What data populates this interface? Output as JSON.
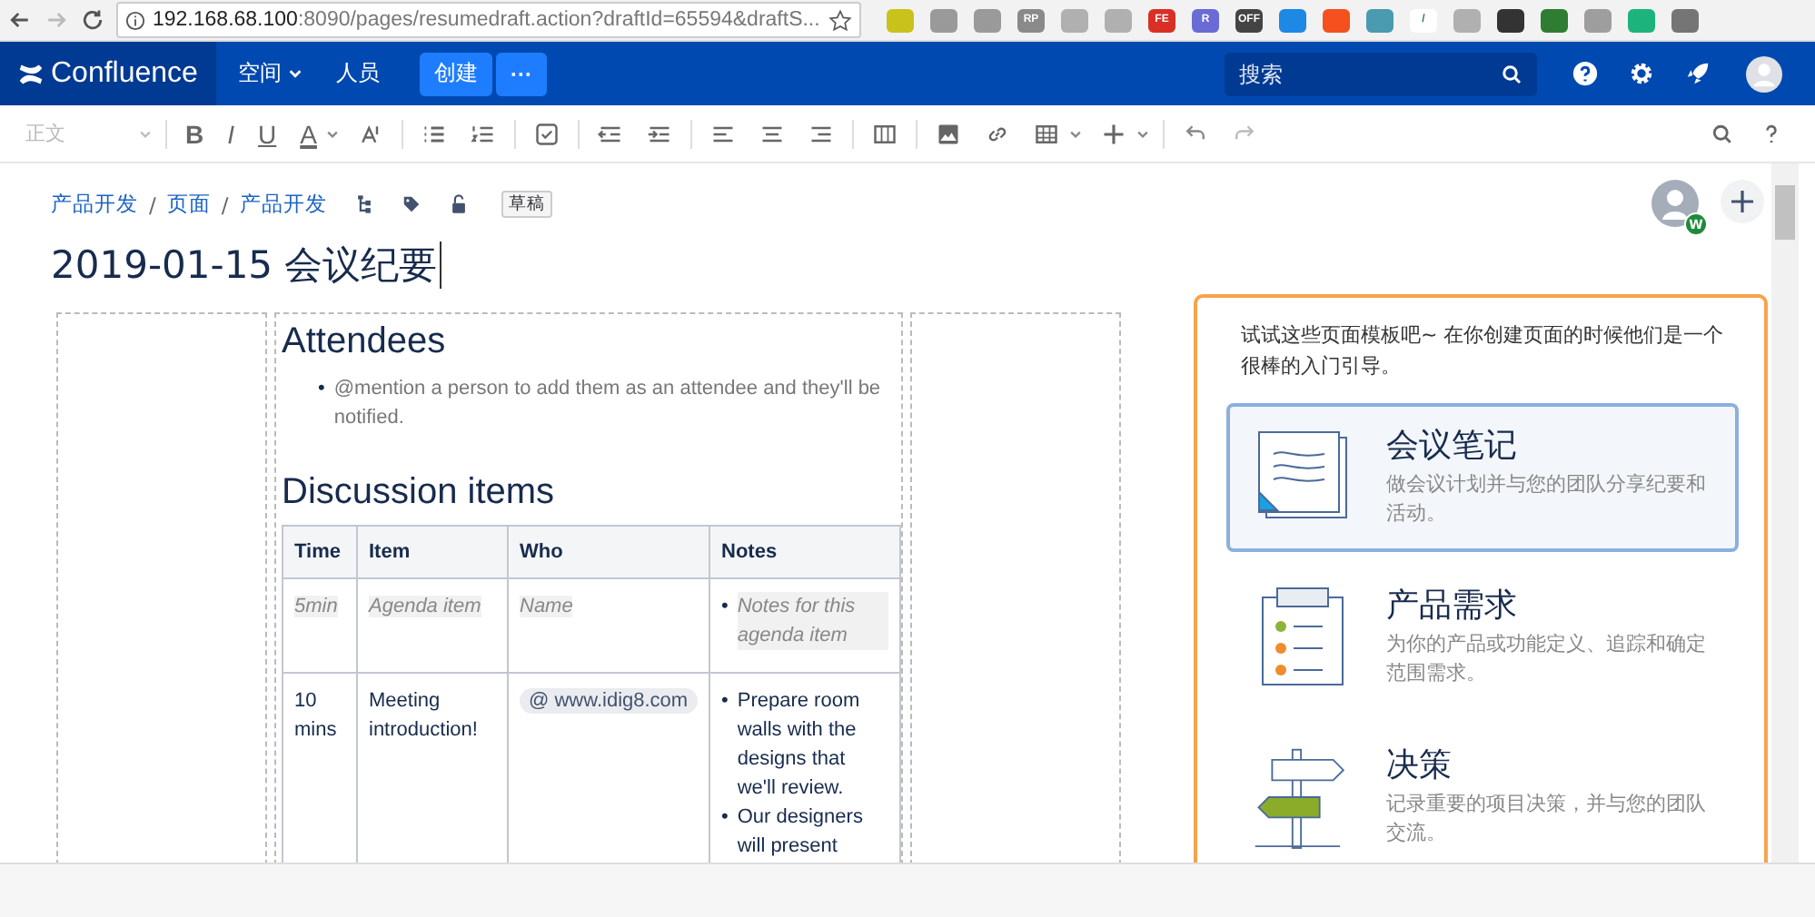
{
  "browser": {
    "url_host": "192.168.68.100",
    "url_path": ":8090/pages/resumedraft.action?draftId=65594&draftS...",
    "extensions": [
      {
        "color": "#c9c21a"
      },
      {
        "color": "#9a9a9a"
      },
      {
        "color": "#9a9a9a"
      },
      {
        "label": "RP",
        "color": "#8a8a8a"
      },
      {
        "color": "#b0b0b0"
      },
      {
        "color": "#b0b0b0"
      },
      {
        "label": "FE",
        "color": "#d93025"
      },
      {
        "label": "R",
        "color": "#6b6bd6"
      },
      {
        "label": "OFF",
        "color": "#444444"
      },
      {
        "color": "#1e88e5"
      },
      {
        "color": "#f4511e"
      },
      {
        "color": "#4a9bb0"
      },
      {
        "label": "/",
        "color": "#ffffff"
      },
      {
        "color": "#b0b0b0"
      },
      {
        "color": "#333333"
      },
      {
        "color": "#2e7d32"
      },
      {
        "color": "#9e9e9e"
      },
      {
        "color": "#1db37d"
      },
      {
        "color": "#757575"
      }
    ]
  },
  "header": {
    "logo": "Confluence",
    "nav": [
      {
        "label": "空间",
        "dropdown": true
      },
      {
        "label": "人员",
        "dropdown": false
      }
    ],
    "create": "创建",
    "more": "···",
    "search": {
      "placeholder": "搜索"
    }
  },
  "toolbar": {
    "style": "正文",
    "bold": "B",
    "italic": "I",
    "underline": "U",
    "text_color_label": "A"
  },
  "breadcrumbs": [
    "产品开发",
    "页面",
    "产品开发"
  ],
  "breadcrumb_separator": "/",
  "bullet": "•",
  "status": "草稿",
  "avatar_badge": "W",
  "title": "2019-01-15 会议纪要",
  "attendees": {
    "heading": "Attendees",
    "hint": "@mention a person to add them as an attendee and they'll be notified."
  },
  "discussion": {
    "heading": "Discussion items",
    "columns": [
      "Time",
      "Item",
      "Who",
      "Notes"
    ],
    "rows": [
      {
        "kind": "placeholder",
        "time": "5min",
        "item": "Agenda item",
        "who": "Name",
        "notes": [
          "Notes for this agenda item"
        ]
      },
      {
        "kind": "content",
        "time": "10 mins",
        "item": "Meeting introduction!",
        "who": "@ www.idig8.com",
        "notes": [
          "Prepare room walls with the designs that we'll review.",
          "Our designers will present"
        ]
      }
    ]
  },
  "templates": {
    "intro": "试试这些页面模板吧~ 在你创建页面的时候他们是一个很棒的入门引导。",
    "items": [
      {
        "kind": "notes",
        "title": "会议笔记",
        "desc": "做会议计划并与您的团队分享纪要和活动。",
        "selected": true
      },
      {
        "kind": "requirements",
        "title": "产品需求",
        "desc": "为你的产品或功能定义、追踪和确定范围需求。",
        "selected": false
      },
      {
        "kind": "decision",
        "title": "决策",
        "desc": "记录重要的项目决策，并与您的团队交流。",
        "selected": false
      }
    ]
  }
}
